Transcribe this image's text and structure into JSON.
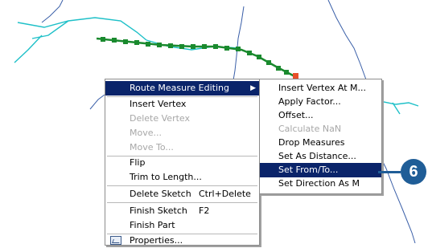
{
  "colors": {
    "accent": "#0a246a",
    "callout": "#1f5d97",
    "river": "#1ec0c8",
    "route": "#1a8a2e",
    "vertex_end": "#e8502a"
  },
  "context_menu": {
    "items": [
      {
        "label": "Route Measure Editing",
        "state": "highlighted",
        "has_submenu": true
      },
      {
        "label": "Insert Vertex",
        "state": "enabled"
      },
      {
        "label": "Delete Vertex",
        "state": "disabled"
      },
      {
        "label": "Move...",
        "state": "disabled"
      },
      {
        "label": "Move To...",
        "state": "disabled"
      },
      {
        "label": "Flip",
        "state": "enabled"
      },
      {
        "label": "Trim to Length...",
        "state": "enabled"
      },
      {
        "label": "Delete Sketch",
        "shortcut": "Ctrl+Delete",
        "state": "enabled"
      },
      {
        "label": "Finish Sketch",
        "shortcut": "F2",
        "state": "enabled"
      },
      {
        "label": "Finish Part",
        "state": "enabled"
      },
      {
        "label": "Properties...",
        "icon": "properties-icon",
        "state": "enabled"
      }
    ]
  },
  "submenu": {
    "items": [
      {
        "label": "Insert Vertex At M...",
        "state": "enabled"
      },
      {
        "label": "Apply Factor...",
        "state": "enabled"
      },
      {
        "label": "Offset...",
        "state": "enabled"
      },
      {
        "label": "Calculate NaN",
        "state": "disabled"
      },
      {
        "label": "Drop Measures",
        "state": "enabled"
      },
      {
        "label": "Set As Distance...",
        "state": "enabled"
      },
      {
        "label": "Set From/To...",
        "state": "highlighted"
      },
      {
        "label": "Set Direction As M",
        "state": "enabled"
      }
    ]
  },
  "callout": {
    "label": "6"
  }
}
